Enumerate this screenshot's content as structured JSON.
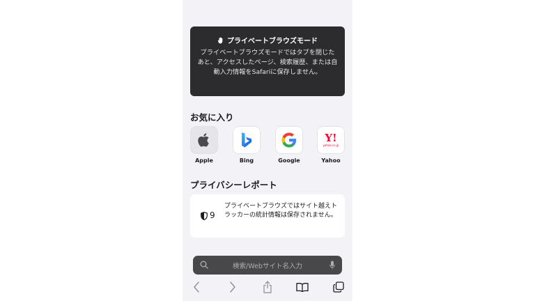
{
  "banner": {
    "title": "プライベートブラウズモード",
    "text": "プライベートブラウズモードではタブを閉じたあと、アクセスしたページ、検索履歴、または自動入力情報をSafariに保存しません。"
  },
  "favorites": {
    "title": "お気に入り",
    "items": [
      {
        "label": "Apple",
        "icon": "apple-logo-icon"
      },
      {
        "label": "Bing",
        "icon": "bing-logo-icon"
      },
      {
        "label": "Google",
        "icon": "google-logo-icon"
      },
      {
        "label": "Yahoo",
        "icon": "yahoo-logo-icon",
        "logo_text": "Y!",
        "logo_subtext": "yahoo.co.jp"
      }
    ]
  },
  "privacy_report": {
    "title": "プライバシーレポート",
    "count": "9",
    "text": "プライベートブラウズではサイト越えトラッカーの統計情報は保存されません。"
  },
  "search": {
    "placeholder": "検索/Webサイト名入力"
  },
  "toolbar": {
    "items": [
      "back-icon",
      "forward-icon",
      "share-icon",
      "bookmarks-icon",
      "tabs-icon"
    ]
  },
  "colors": {
    "banner_bg": "#2c2c2e",
    "page_bg": "#f2f2f7",
    "search_bg": "#48484a",
    "accent": "#007aff"
  }
}
